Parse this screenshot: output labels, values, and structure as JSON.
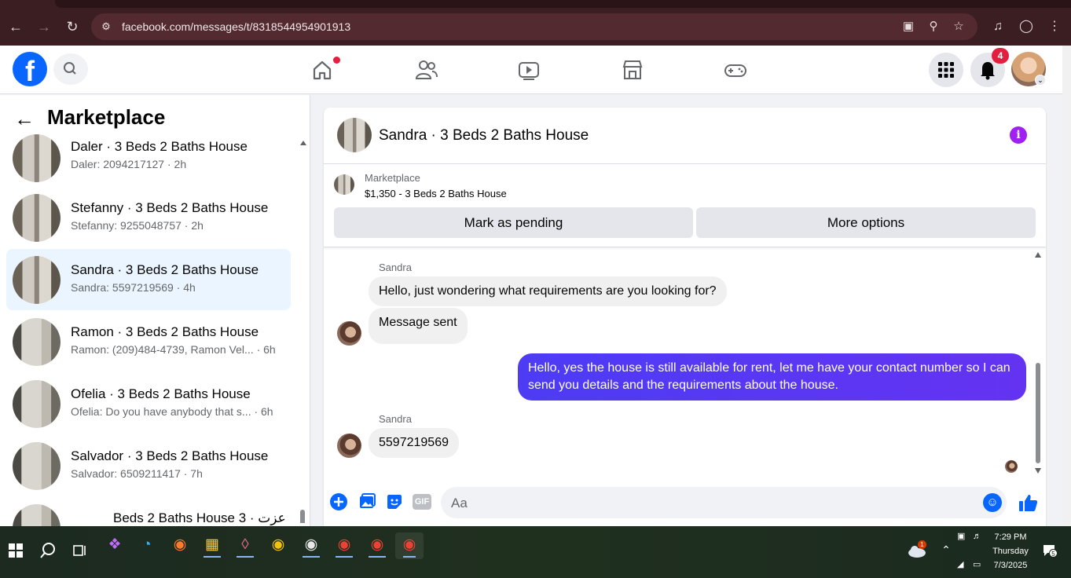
{
  "browser": {
    "url": "facebook.com/messages/t/8318544954901913",
    "icons": [
      "back-icon",
      "forward-icon",
      "reload-icon",
      "site-settings-icon",
      "install-app-icon",
      "zoom-icon",
      "bookmark-star-icon",
      "media-icon",
      "profile-icon",
      "menu-icon"
    ]
  },
  "header": {
    "logo_letter": "f",
    "notification_count": "4",
    "nav_icons": [
      "home-icon",
      "friends-icon",
      "watch-icon",
      "marketplace-icon",
      "gaming-icon"
    ]
  },
  "left_panel": {
    "title": "Marketplace",
    "conversations": [
      {
        "title": "Daler · 3 Beds 2 Baths House",
        "subtitle": "Daler: 2094217127 · 2h"
      },
      {
        "title": "Stefanny · 3 Beds 2 Baths House",
        "subtitle": "Stefanny: 9255048757 · 2h"
      },
      {
        "title": "Sandra · 3 Beds 2 Baths House",
        "subtitle": "Sandra: 5597219569 · 4h"
      },
      {
        "title": "Ramon · 3 Beds 2 Baths House",
        "subtitle": "Ramon: (209)484-4739, Ramon Vel...  · 6h"
      },
      {
        "title": "Ofelia · 3 Beds 2 Baths House",
        "subtitle": "Ofelia: Do you have anybody that s...  · 6h"
      },
      {
        "title": "Salvador · 3 Beds 2 Baths House",
        "subtitle": "Salvador: 6509211417 · 7h"
      },
      {
        "title": "عزت · 3 Beds 2 Baths House",
        "subtitle": ""
      }
    ]
  },
  "chat": {
    "header_name": "Sandra · 3 Beds 2 Baths House",
    "marketplace_label": "Marketplace",
    "listing": "$1,350 - 3 Beds 2 Baths House",
    "mark_pending": "Mark as pending",
    "more_options": "More options",
    "messages": [
      {
        "sender": "Sandra",
        "text": "Hello, just wondering what requirements are you looking for?"
      },
      {
        "text": "Message sent"
      },
      {
        "text": "Hello, yes the house is still available for rent, let me have your contact number so I can send you details and the requirements about the house."
      },
      {
        "sender": "Sandra",
        "text": "5597219569"
      }
    ],
    "composer_placeholder": "Aa",
    "gif_label": "GIF"
  },
  "taskbar": {
    "time": "7:29 PM",
    "day": "Thursday",
    "date": "7/3/2025",
    "weather_badge": "1",
    "notification_badge": "5"
  }
}
